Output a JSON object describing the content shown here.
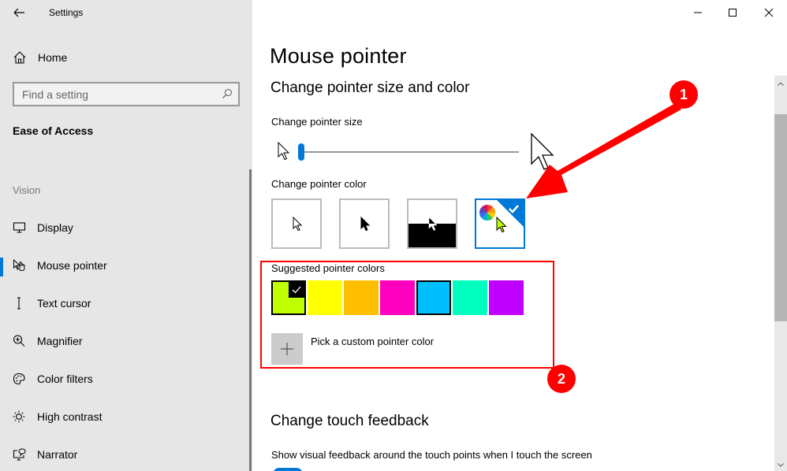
{
  "window": {
    "title": "Settings",
    "controls": {
      "minimize": "minimize-icon",
      "maximize": "maximize-icon",
      "close": "close-icon"
    }
  },
  "sidebar": {
    "home_label": "Home",
    "search": {
      "placeholder": "Find a setting",
      "value": ""
    },
    "section_title": "Ease of Access",
    "group_label": "Vision",
    "items": [
      {
        "label": "Display",
        "icon": "monitor-icon",
        "selected": false
      },
      {
        "label": "Mouse pointer",
        "icon": "mouse-pointer-icon",
        "selected": true
      },
      {
        "label": "Text cursor",
        "icon": "text-cursor-icon",
        "selected": false
      },
      {
        "label": "Magnifier",
        "icon": "magnifier-icon",
        "selected": false
      },
      {
        "label": "Color filters",
        "icon": "palette-icon",
        "selected": false
      },
      {
        "label": "High contrast",
        "icon": "sun-icon",
        "selected": false
      },
      {
        "label": "Narrator",
        "icon": "narrator-icon",
        "selected": false
      }
    ]
  },
  "main": {
    "page_title": "Mouse pointer",
    "section1_title": "Change pointer size and color",
    "pointer_size_label": "Change pointer size",
    "pointer_size_value": 1,
    "pointer_size_range": [
      1,
      15
    ],
    "pointer_color_label": "Change pointer color",
    "pointer_color_options": [
      {
        "name": "white",
        "selected": false
      },
      {
        "name": "black",
        "selected": false
      },
      {
        "name": "inverted",
        "selected": false
      },
      {
        "name": "custom",
        "selected": true
      }
    ],
    "suggested_colors_label": "Suggested pointer colors",
    "suggested_colors": [
      {
        "hex": "#bfff00",
        "selected": true
      },
      {
        "hex": "#ffff00",
        "selected": false
      },
      {
        "hex": "#ffbf00",
        "selected": false
      },
      {
        "hex": "#ff00bf",
        "selected": false
      },
      {
        "hex": "#00bfff",
        "selected": false,
        "outlined": true
      },
      {
        "hex": "#00ffbf",
        "selected": false
      },
      {
        "hex": "#bf00ff",
        "selected": false
      }
    ],
    "custom_color_label": "Pick a custom pointer color",
    "section2_title": "Change touch feedback",
    "touch_feedback_label": "Show visual feedback around the touch points when I touch the screen"
  },
  "annotations": {
    "badge1": "1",
    "badge2": "2",
    "color": "#ff0000"
  },
  "colors": {
    "accent": "#0078d7",
    "sidebar_bg": "#e6e6e6"
  }
}
